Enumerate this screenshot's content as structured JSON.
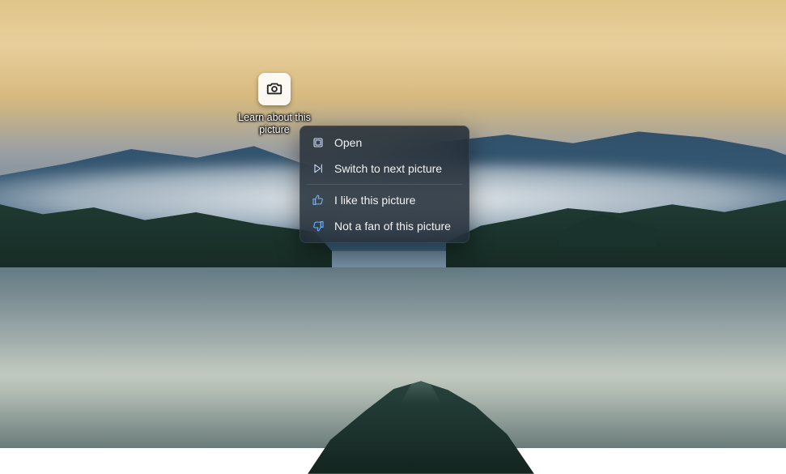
{
  "desktop": {
    "spotlight_icon_label": "Learn about this picture"
  },
  "context_menu": {
    "items": [
      {
        "icon": "open-icon",
        "label": "Open"
      },
      {
        "icon": "next-picture-icon",
        "label": "Switch to next picture"
      },
      {
        "icon": "thumbs-up-icon",
        "label": "I like this picture"
      },
      {
        "icon": "thumbs-down-icon",
        "label": "Not a fan of this picture"
      }
    ],
    "separator_after_index": 1
  }
}
